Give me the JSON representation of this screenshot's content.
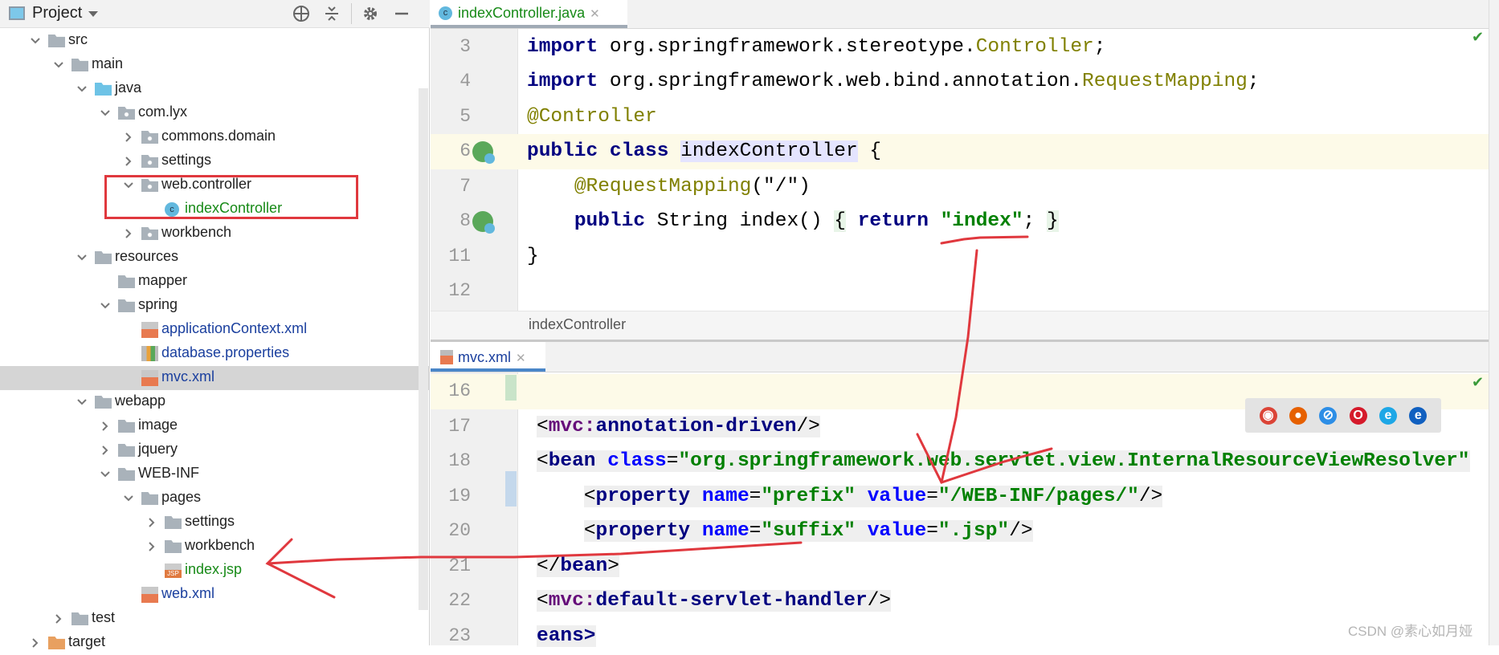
{
  "project_panel": {
    "title": "Project",
    "tree": [
      {
        "label": "src",
        "level": 0,
        "state": "open",
        "icon": "folder"
      },
      {
        "label": "main",
        "level": 1,
        "state": "open",
        "icon": "folder"
      },
      {
        "label": "java",
        "level": 2,
        "state": "open",
        "icon": "source-folder"
      },
      {
        "label": "com.lyx",
        "level": 3,
        "state": "open",
        "icon": "package"
      },
      {
        "label": "commons.domain",
        "level": 4,
        "state": "closed",
        "icon": "package"
      },
      {
        "label": "settings",
        "level": 4,
        "state": "closed",
        "icon": "package"
      },
      {
        "label": "web.controller",
        "level": 4,
        "state": "open",
        "icon": "package"
      },
      {
        "label": "indexController",
        "level": 5,
        "state": "leaf",
        "icon": "class",
        "color": "green"
      },
      {
        "label": "workbench",
        "level": 4,
        "state": "closed",
        "icon": "package"
      },
      {
        "label": "resources",
        "level": 2,
        "state": "open",
        "icon": "resources-folder"
      },
      {
        "label": "mapper",
        "level": 3,
        "state": "leaf",
        "icon": "folder"
      },
      {
        "label": "spring",
        "level": 3,
        "state": "open",
        "icon": "folder"
      },
      {
        "label": "applicationContext.xml",
        "level": 4,
        "state": "leaf",
        "icon": "spring-xml",
        "color": "blue"
      },
      {
        "label": "database.properties",
        "level": 4,
        "state": "leaf",
        "icon": "properties",
        "color": "blue"
      },
      {
        "label": "mvc.xml",
        "level": 4,
        "state": "leaf",
        "icon": "spring-xml",
        "color": "blue",
        "selected": true
      },
      {
        "label": "webapp",
        "level": 2,
        "state": "open",
        "icon": "folder"
      },
      {
        "label": "image",
        "level": 3,
        "state": "closed",
        "icon": "folder"
      },
      {
        "label": "jquery",
        "level": 3,
        "state": "closed",
        "icon": "folder"
      },
      {
        "label": "WEB-INF",
        "level": 3,
        "state": "open",
        "icon": "folder"
      },
      {
        "label": "pages",
        "level": 4,
        "state": "open",
        "icon": "folder"
      },
      {
        "label": "settings",
        "level": 5,
        "state": "closed",
        "icon": "folder"
      },
      {
        "label": "workbench",
        "level": 5,
        "state": "closed",
        "icon": "folder"
      },
      {
        "label": "index.jsp",
        "level": 5,
        "state": "leaf",
        "icon": "jsp",
        "color": "green"
      },
      {
        "label": "web.xml",
        "level": 4,
        "state": "leaf",
        "icon": "spring-xml",
        "color": "blue"
      },
      {
        "label": "test",
        "level": 1,
        "state": "closed",
        "icon": "folder"
      },
      {
        "label": "target",
        "level": 0,
        "state": "closed",
        "icon": "excluded-folder"
      }
    ]
  },
  "editor_top": {
    "tab": "indexController.java",
    "breadcrumb": "indexController",
    "lines": [
      {
        "n": "3",
        "tokens": [
          {
            "t": "import",
            "c": "kw"
          },
          {
            "t": " org.springframework.stereotype."
          },
          {
            "t": "Controller",
            "c": "an"
          },
          {
            "t": ";"
          }
        ]
      },
      {
        "n": "4",
        "tokens": [
          {
            "t": "import",
            "c": "kw"
          },
          {
            "t": " org.springframework.web.bind.annotation."
          },
          {
            "t": "RequestMapping",
            "c": "an"
          },
          {
            "t": ";"
          }
        ]
      },
      {
        "n": "5",
        "tokens": [
          {
            "t": "@Controller",
            "c": "an"
          }
        ]
      },
      {
        "n": "6",
        "current": true,
        "tokens": [
          {
            "t": "public class",
            "c": "kw"
          },
          {
            "t": " "
          },
          {
            "t": "indexController",
            "c": "hl"
          },
          {
            "t": " {"
          }
        ]
      },
      {
        "n": "7",
        "tokens": [
          {
            "t": "    "
          },
          {
            "t": "@RequestMapping",
            "c": "an"
          },
          {
            "t": "(\"/\")"
          }
        ]
      },
      {
        "n": "8",
        "tokens": [
          {
            "t": "    "
          },
          {
            "t": "public",
            "c": "kw"
          },
          {
            "t": " String index() "
          },
          {
            "t": "{",
            "c": "br"
          },
          {
            "t": " "
          },
          {
            "t": "return",
            "c": "kw"
          },
          {
            "t": " "
          },
          {
            "t": "\"index\"",
            "c": "st"
          },
          {
            "t": "; "
          },
          {
            "t": "}",
            "c": "br"
          }
        ]
      },
      {
        "n": "11",
        "tokens": [
          {
            "t": "}"
          }
        ]
      },
      {
        "n": "12",
        "tokens": []
      }
    ]
  },
  "editor_bottom": {
    "tab": "mvc.xml",
    "lines": [
      {
        "n": "16",
        "current": true,
        "tokens": []
      },
      {
        "n": "17",
        "tokens": [
          {
            "t": "<",
            "c": "bg"
          },
          {
            "t": "mvc:",
            "c": "ns bg"
          },
          {
            "t": "annotation-driven",
            "c": "tg bg"
          },
          {
            "t": "/>",
            "c": "bg"
          }
        ]
      },
      {
        "n": "18",
        "tokens": [
          {
            "t": "<",
            "c": "bg"
          },
          {
            "t": "bean",
            "c": "tg bg"
          },
          {
            "t": " ",
            "c": "bg"
          },
          {
            "t": "class",
            "c": "at bg"
          },
          {
            "t": "=",
            "c": "bg"
          },
          {
            "t": "\"org.springframework.web.servlet.view.InternalResourceViewResolver\"",
            "c": "st bg"
          }
        ]
      },
      {
        "n": "19",
        "tokens": [
          {
            "t": "    "
          },
          {
            "t": "<",
            "c": "bg"
          },
          {
            "t": "property",
            "c": "tg bg"
          },
          {
            "t": " ",
            "c": "bg"
          },
          {
            "t": "name",
            "c": "at bg"
          },
          {
            "t": "=",
            "c": "bg"
          },
          {
            "t": "\"prefix\"",
            "c": "st bg"
          },
          {
            "t": " ",
            "c": "bg"
          },
          {
            "t": "value",
            "c": "at bg"
          },
          {
            "t": "=",
            "c": "bg"
          },
          {
            "t": "\"/WEB-INF/pages/\"",
            "c": "st bg"
          },
          {
            "t": "/>",
            "c": "bg"
          }
        ]
      },
      {
        "n": "20",
        "tokens": [
          {
            "t": "    "
          },
          {
            "t": "<",
            "c": "bg"
          },
          {
            "t": "property",
            "c": "tg bg"
          },
          {
            "t": " ",
            "c": "bg"
          },
          {
            "t": "name",
            "c": "at bg"
          },
          {
            "t": "=",
            "c": "bg"
          },
          {
            "t": "\"suffix\"",
            "c": "st bg"
          },
          {
            "t": " ",
            "c": "bg"
          },
          {
            "t": "value",
            "c": "at bg"
          },
          {
            "t": "=",
            "c": "bg"
          },
          {
            "t": "\".jsp\"",
            "c": "st bg"
          },
          {
            "t": "/>",
            "c": "bg"
          }
        ]
      },
      {
        "n": "21",
        "tokens": [
          {
            "t": "</",
            "c": "bg"
          },
          {
            "t": "bean",
            "c": "tg bg"
          },
          {
            "t": ">",
            "c": "bg"
          }
        ]
      },
      {
        "n": "22",
        "tokens": [
          {
            "t": "<",
            "c": "bg"
          },
          {
            "t": "mvc:",
            "c": "ns bg"
          },
          {
            "t": "default-servlet-handler",
            "c": "tg bg"
          },
          {
            "t": "/>",
            "c": "bg"
          }
        ]
      },
      {
        "n": "23",
        "tokens": [
          {
            "t": "eans>",
            "c": "tg bg"
          }
        ]
      }
    ]
  },
  "browsers": [
    "chrome",
    "firefox",
    "safari",
    "opera",
    "ie",
    "edge"
  ],
  "watermark": "CSDN @素心如月娅",
  "colors": {
    "annotation_red": "#e0383e",
    "keyword": "#000080",
    "string": "#008000",
    "annotation": "#808000"
  }
}
